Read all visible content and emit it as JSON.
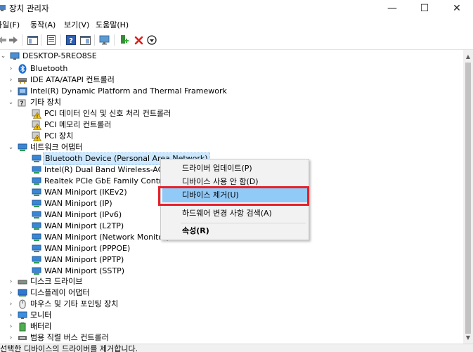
{
  "window": {
    "title": "장치 관리자",
    "minimize_glyph": "—",
    "maximize_glyph": "☐",
    "close_glyph": "✕"
  },
  "menu": [
    {
      "label": "파일(F)"
    },
    {
      "label": "동작(A)"
    },
    {
      "label": "보기(V)"
    },
    {
      "label": "도움말(H)"
    }
  ],
  "tree": {
    "root": "DESKTOP-5REO8SE",
    "categories": {
      "bluetooth": "Bluetooth",
      "ide": "IDE ATA/ATAPI 컨트롤러",
      "intel_platform": "Intel(R) Dynamic Platform and Thermal Framework",
      "other": "기타 장치",
      "network": "네트워크 어댑터",
      "disk": "디스크 드라이브",
      "display": "디스플레이 어댑터",
      "mouse": "마우스 및 기타 포인팅 장치",
      "monitor": "모니터",
      "battery": "배터리",
      "usb": "범용 직렬 버스 컨트롤러"
    },
    "other_devices": [
      "PCI 데이터 인식 및 신호 처리 컨트롤러",
      "PCI 메모리 컨트롤러",
      "PCI 장치"
    ],
    "network_adapters": [
      "Bluetooth Device (Personal Area Network)",
      "Intel(R) Dual Band Wireless-AC 7265",
      "Realtek PCIe GbE Family Controller",
      "WAN Miniport (IKEv2)",
      "WAN Miniport (IP)",
      "WAN Miniport (IPv6)",
      "WAN Miniport (L2TP)",
      "WAN Miniport (Network Monitor)",
      "WAN Miniport (PPPOE)",
      "WAN Miniport (PPTP)",
      "WAN Miniport (SSTP)"
    ]
  },
  "context_menu": {
    "items": [
      "드라이버 업데이트(P)",
      "디바이스 사용 안 함(D)",
      "디바이스 제거(U)",
      "하드웨어 변경 사항 검색(A)",
      "속성(R)"
    ]
  },
  "status": {
    "text": "선택한 디바이스의 드라이버를 제거합니다."
  },
  "colors": {
    "highlight_box": "#e8202a",
    "menu_highlight": "#91c9f7",
    "selection": "#cce8ff"
  }
}
